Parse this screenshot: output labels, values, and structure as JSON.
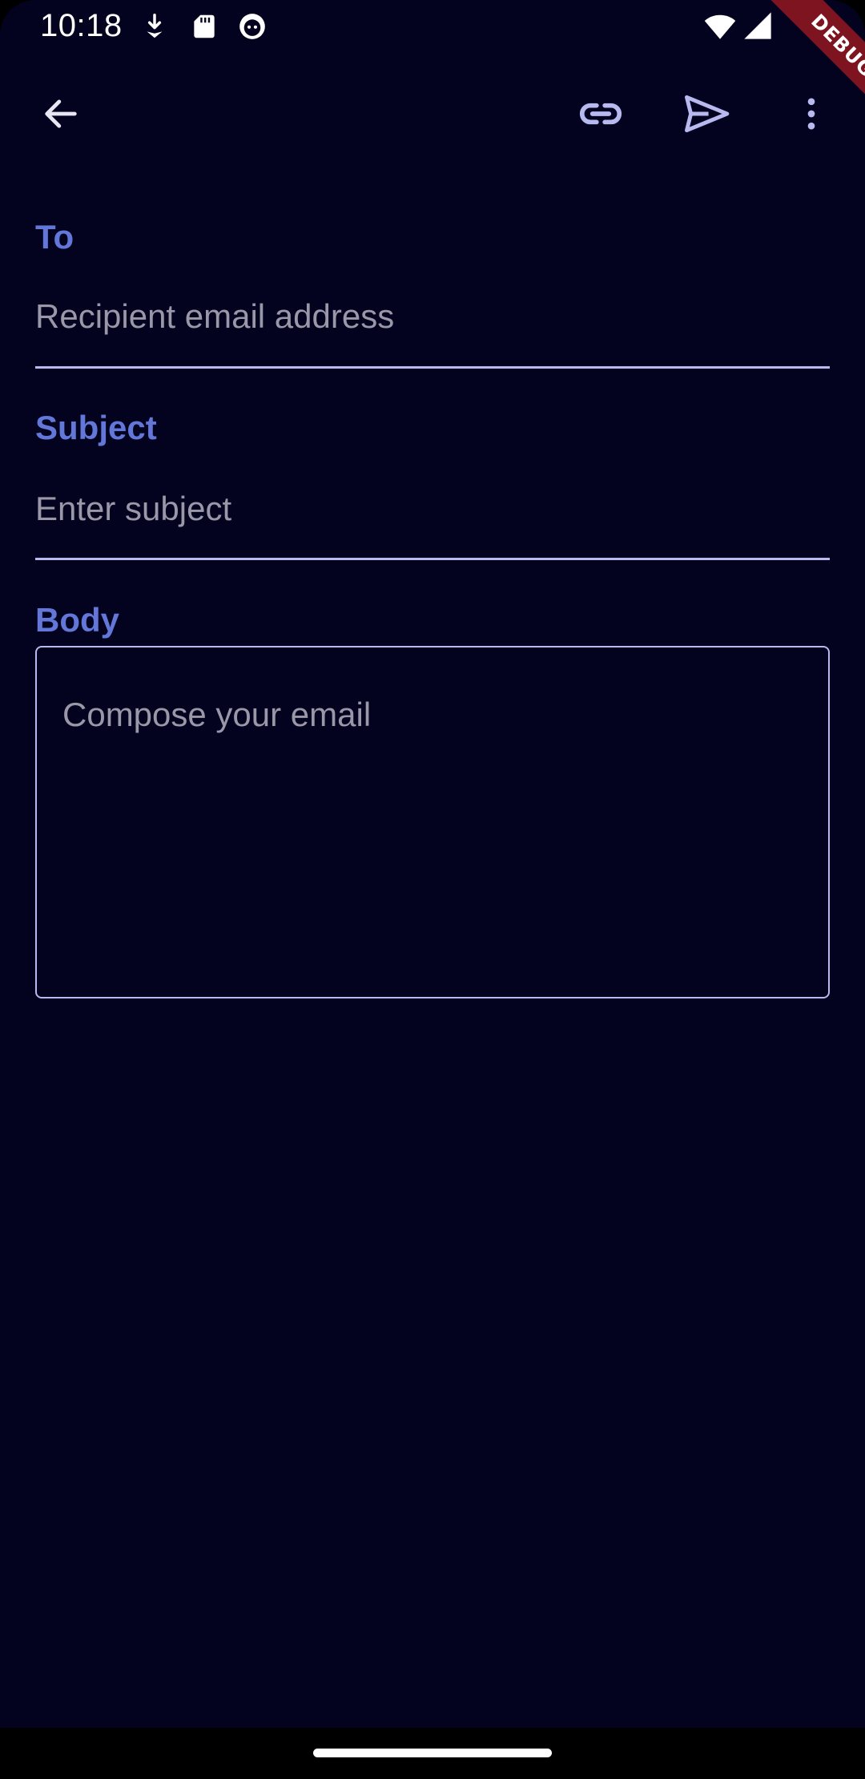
{
  "status_bar": {
    "time": "10:18",
    "icons": [
      "download-icon",
      "sd-card-icon",
      "cat-face-icon",
      "wifi-icon",
      "cell-signal-icon"
    ]
  },
  "debug_banner": "DEBUG",
  "app_bar": {
    "icons": [
      "back-arrow-icon",
      "link-icon",
      "send-icon",
      "more-vert-icon"
    ]
  },
  "form": {
    "to": {
      "label": "To",
      "placeholder": "Recipient email address"
    },
    "subject": {
      "label": "Subject",
      "placeholder": "Enter subject"
    },
    "body": {
      "label": "Body",
      "placeholder": "Compose your email"
    }
  },
  "colors": {
    "background": "#03021f",
    "label": "#6377d9",
    "placeholder": "#9a97a8",
    "outline": "#b7b9ef",
    "debug_banner": "#7d1420"
  }
}
